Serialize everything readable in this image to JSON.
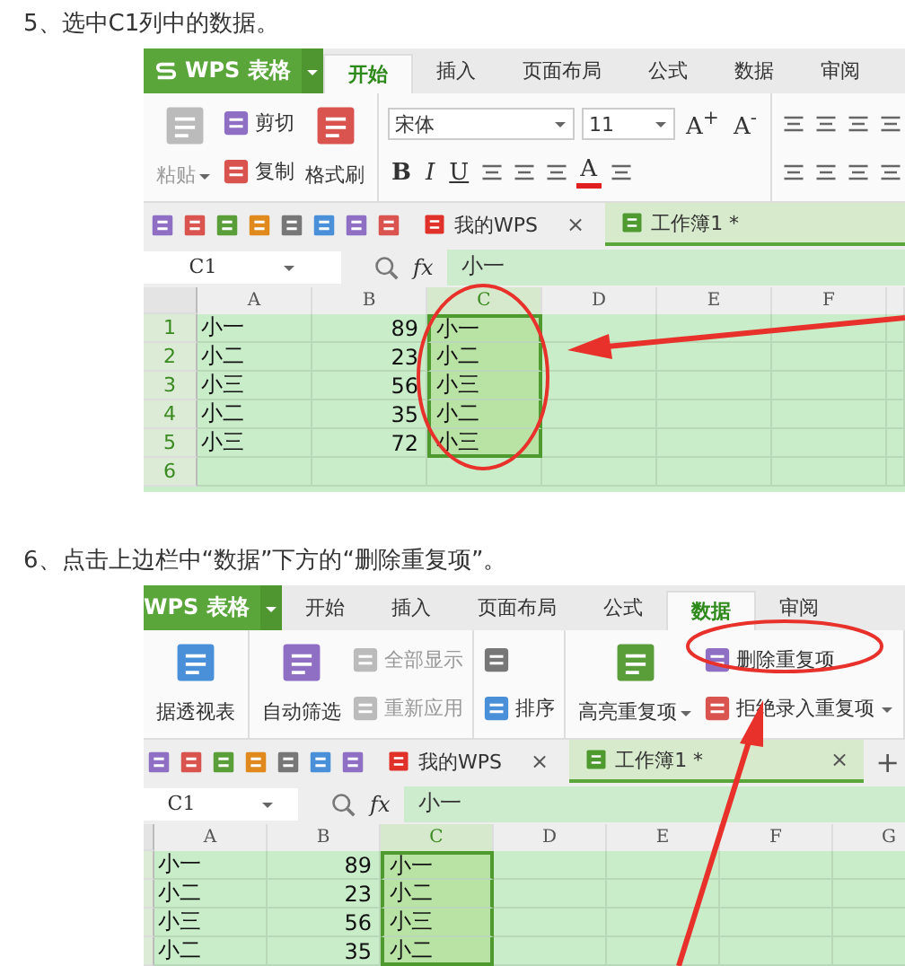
{
  "steps": [
    {
      "caption": "5、选中C1列中的数据。",
      "shot": {
        "app_title": "WPS 表格",
        "tabs": [
          {
            "label": "开始",
            "selected": true
          },
          {
            "label": "插入",
            "selected": false
          },
          {
            "label": "页面布局",
            "selected": false
          },
          {
            "label": "公式",
            "selected": false
          },
          {
            "label": "数据",
            "selected": false
          },
          {
            "label": "审阅",
            "selected": false
          }
        ],
        "ribbon": [
          {
            "cols": [
              {
                "kind": "big",
                "label": "粘贴",
                "caret": true,
                "disabled": true
              },
              {
                "kind": "pair",
                "items": [
                  {
                    "label": "剪切",
                    "disabled": false
                  },
                  {
                    "label": "复制",
                    "disabled": false
                  }
                ]
              },
              {
                "kind": "big",
                "label": "格式刷",
                "caret": false,
                "disabled": false
              }
            ]
          },
          {
            "cols": [
              {
                "kind": "lines",
                "lines": [
                  {
                    "items": [
                      {
                        "kind": "font",
                        "label": "宋体"
                      },
                      {
                        "kind": "size",
                        "label": "11"
                      },
                      {
                        "kind": "letter",
                        "label": "A$^{+}$"
                      },
                      {
                        "kind": "letter",
                        "label": "A$^{-}$"
                      }
                    ]
                  },
                  {
                    "items": [
                      {
                        "kind": "bold",
                        "label": "B"
                      },
                      {
                        "kind": "italic",
                        "label": "I"
                      },
                      {
                        "kind": "underline",
                        "label": "U"
                      },
                      {
                        "kind": "icon"
                      },
                      {
                        "kind": "icon"
                      },
                      {
                        "kind": "icon"
                      },
                      {
                        "kind": "colored",
                        "label": "A"
                      },
                      {
                        "kind": "icon"
                      }
                    ]
                  }
                ]
              }
            ]
          },
          {
            "cols": [
              {
                "kind": "lines",
                "lines": [
                  {
                    "items": [
                      {
                        "kind": "icon"
                      },
                      {
                        "kind": "icon"
                      },
                      {
                        "kind": "icon"
                      },
                      {
                        "kind": "icon"
                      }
                    ]
                  },
                  {
                    "items": [
                      {
                        "kind": "icon"
                      },
                      {
                        "kind": "icon"
                      },
                      {
                        "kind": "icon"
                      },
                      {
                        "kind": "icon"
                      }
                    ]
                  }
                ]
              }
            ]
          }
        ],
        "doc_tabs": [
          {
            "label": "我的WPS",
            "selected": false,
            "close": "×"
          },
          {
            "label": "工作簿1 *",
            "selected": true
          }
        ],
        "name_box": "C1",
        "fx": "fx",
        "formula": "小一",
        "columns": [
          {
            "label": "A",
            "selected": false
          },
          {
            "label": "B",
            "selected": false
          },
          {
            "label": "C",
            "selected": true
          },
          {
            "label": "D",
            "selected": false
          },
          {
            "label": "E",
            "selected": false
          },
          {
            "label": "F",
            "selected": false
          }
        ],
        "rows": [
          {
            "number": "1",
            "cells": [
              "小一",
              "89",
              "小一"
            ]
          },
          {
            "number": "2",
            "cells": [
              "小二",
              "23",
              "小二"
            ]
          },
          {
            "number": "3",
            "cells": [
              "小三",
              "56",
              "小三"
            ]
          },
          {
            "number": "4",
            "cells": [
              "小二",
              "35",
              "小二"
            ]
          },
          {
            "number": "5",
            "cells": [
              "小三",
              "72",
              "小三"
            ]
          },
          {
            "number": "6",
            "cells": []
          }
        ]
      }
    },
    {
      "caption": "6、点击上边栏中“数据”下方的“删除重复项”。",
      "shot": {
        "app_title": "WPS 表格",
        "tabs": [
          {
            "label": "开始",
            "selected": false
          },
          {
            "label": "插入",
            "selected": false
          },
          {
            "label": "页面布局",
            "selected": false
          },
          {
            "label": "公式",
            "selected": false
          },
          {
            "label": "数据",
            "selected": true
          },
          {
            "label": "审阅",
            "selected": false
          }
        ],
        "ribbon": [
          {
            "cols": [
              {
                "kind": "big",
                "label": "据透视表",
                "caret": false,
                "disabled": false
              }
            ]
          },
          {
            "cols": [
              {
                "kind": "big",
                "label": "自动筛选",
                "caret": false,
                "disabled": false
              },
              {
                "kind": "pair",
                "items": [
                  {
                    "label": "全部显示",
                    "disabled": true
                  },
                  {
                    "label": "重新应用",
                    "disabled": true
                  }
                ]
              }
            ]
          },
          {
            "cols": [
              {
                "kind": "pair",
                "items": [
                  {
                    "disabled": false
                  },
                  {
                    "label": "排序",
                    "disabled": false
                  }
                ]
              }
            ]
          },
          {
            "cols": [
              {
                "kind": "big",
                "label": "高亮重复项",
                "caret": true,
                "disabled": false
              },
              {
                "kind": "pair",
                "items": [
                  {
                    "label": "删除重复项",
                    "disabled": false
                  },
                  {
                    "label": "拒绝录入重复项",
                    "disabled": false,
                    "caret": true
                  }
                ]
              }
            ]
          }
        ],
        "doc_tabs": [
          {
            "label": "我的WPS",
            "selected": false,
            "close": "×"
          },
          {
            "label": "工作簿1 *",
            "selected": true,
            "close": "×"
          }
        ],
        "new_tab": "+",
        "name_box": "C1",
        "fx": "fx",
        "formula": "小一",
        "columns": [
          {
            "label": "A",
            "selected": false
          },
          {
            "label": "B",
            "selected": false
          },
          {
            "label": "C",
            "selected": true
          },
          {
            "label": "D",
            "selected": false
          },
          {
            "label": "E",
            "selected": false
          },
          {
            "label": "F",
            "selected": false
          },
          {
            "label": "G",
            "selected": false
          }
        ],
        "rows": [
          {
            "cells": [
              "小一",
              "89",
              "小一"
            ]
          },
          {
            "cells": [
              "小二",
              "23",
              "小二"
            ]
          },
          {
            "cells": [
              "小三",
              "56",
              "小三"
            ]
          },
          {
            "cells": [
              "小二",
              "35",
              "小二"
            ]
          }
        ]
      }
    }
  ]
}
